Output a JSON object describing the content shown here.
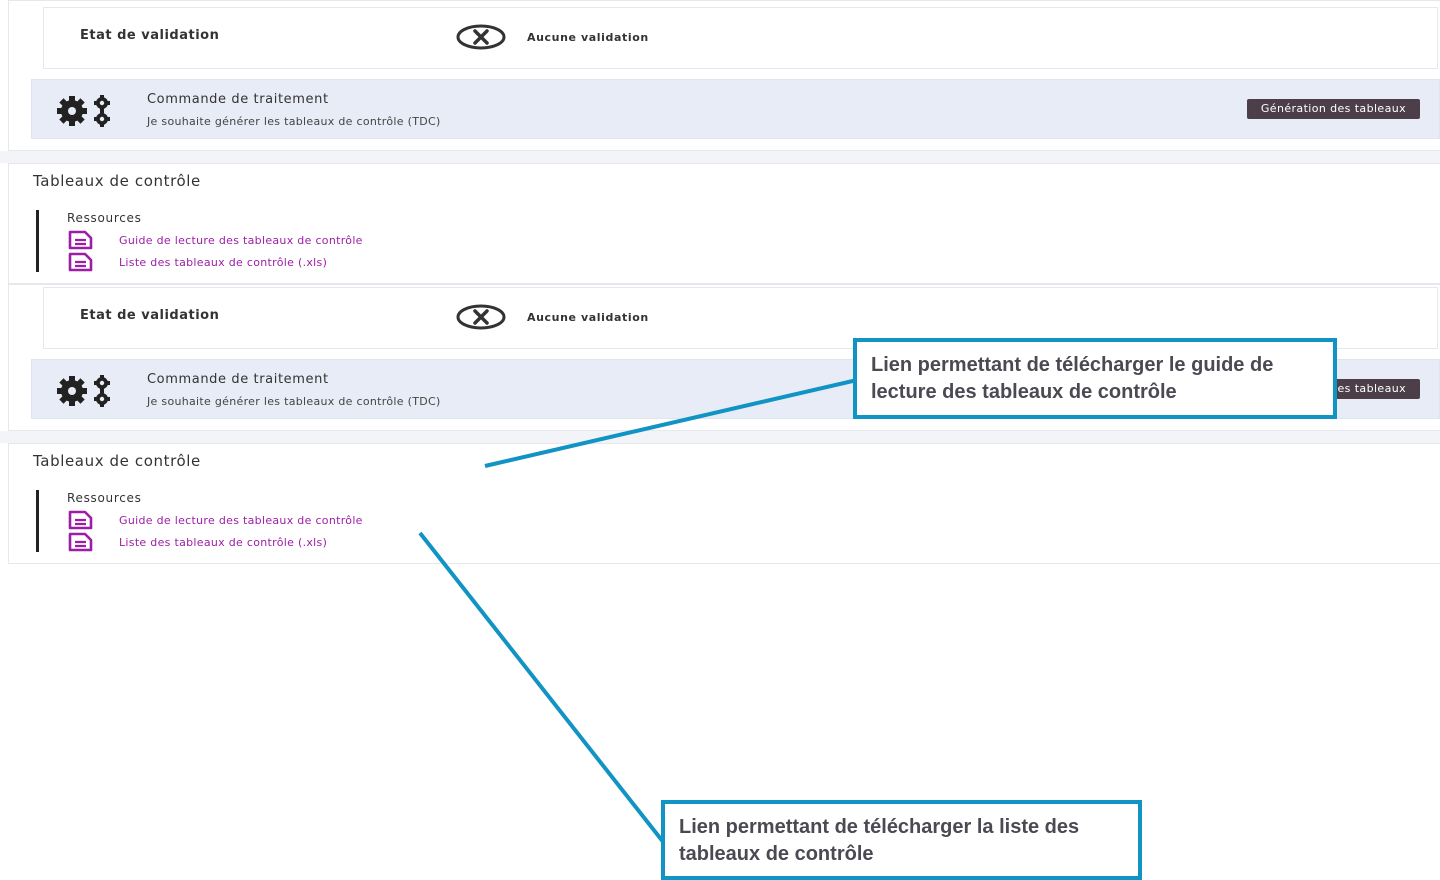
{
  "blocks": [
    {
      "validation": {
        "label": "Etat de validation",
        "status": "Aucune validation",
        "icon": "circle-x-icon"
      },
      "command": {
        "title": "Commande de traitement",
        "description": "Je souhaite générer les tableaux de contrôle (TDC)",
        "button": "Génération des tableaux",
        "icon": "gears-icon"
      },
      "section": {
        "title": "Tableaux de contrôle",
        "resources_title": "Ressources",
        "links": [
          {
            "label": "Guide de lecture des tableaux de contrôle",
            "icon": "document-icon"
          },
          {
            "label": "Liste des tableaux de contrôle (.xls)",
            "icon": "document-icon"
          }
        ]
      }
    },
    {
      "validation": {
        "label": "Etat de validation",
        "status": "Aucune validation",
        "icon": "circle-x-icon"
      },
      "command": {
        "title": "Commande de traitement",
        "description": "Je souhaite générer les tableaux de contrôle (TDC)",
        "button": "Génération des tableaux",
        "icon": "gears-icon"
      },
      "section": {
        "title": "Tableaux de contrôle",
        "resources_title": "Ressources",
        "links": [
          {
            "label": "Guide de lecture des tableaux de contrôle",
            "icon": "document-icon"
          },
          {
            "label": "Liste des tableaux de contrôle (.xls)",
            "icon": "document-icon"
          }
        ]
      }
    }
  ],
  "annotations": {
    "guide": "Lien permettant de télécharger le guide de lecture des tableaux de contrôle",
    "list": "Lien permettant de télécharger la liste des tableaux de contrôle"
  },
  "colors": {
    "link": "#9b1fa5",
    "button": "#4d3f4a",
    "command_bg": "#e8ecf6",
    "callout_border": "#1193c4"
  }
}
